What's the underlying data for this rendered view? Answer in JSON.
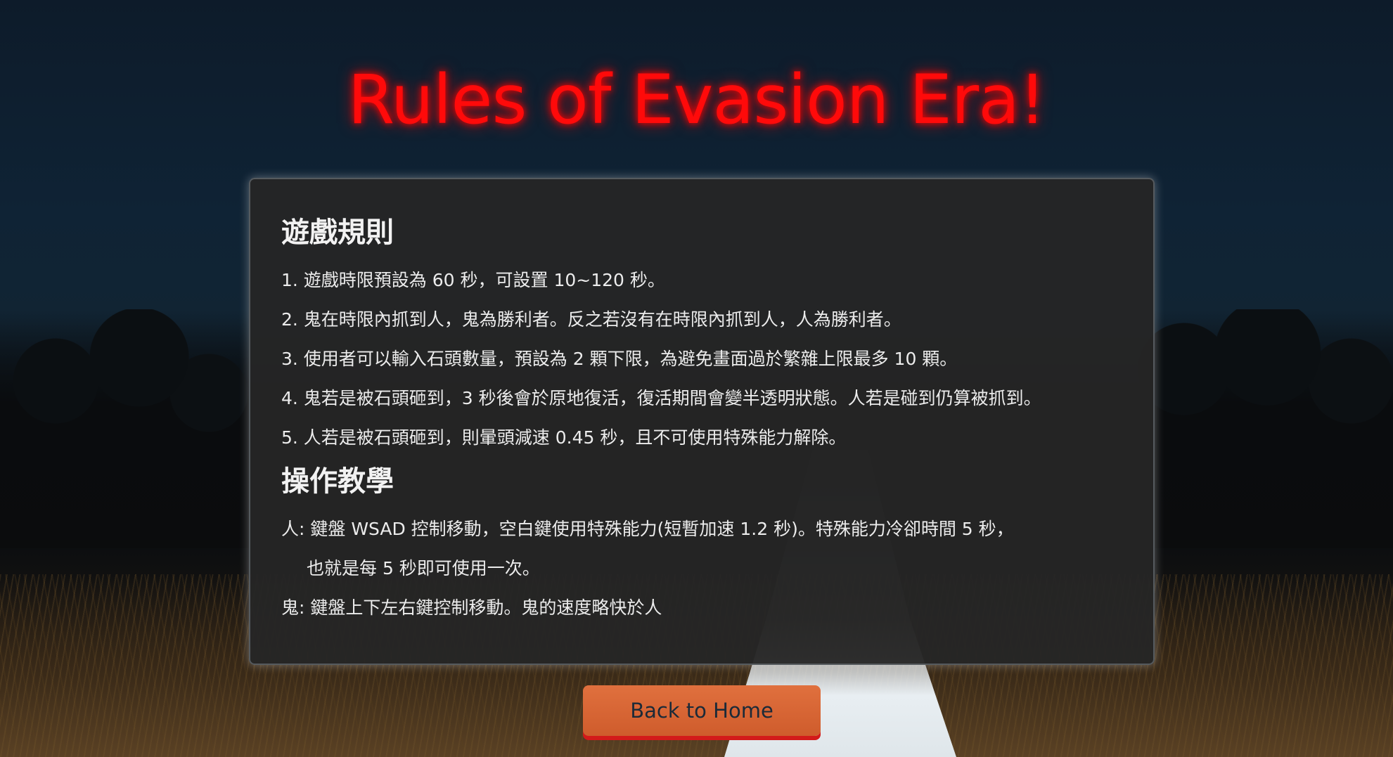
{
  "page": {
    "title": "Rules of Evasion Era!"
  },
  "rules": {
    "heading": "遊戲規則",
    "items": [
      "1. 遊戲時限預設為 60 秒，可設置 10~120 秒。",
      "2. 鬼在時限內抓到人，鬼為勝利者。反之若沒有在時限內抓到人，人為勝利者。",
      "3. 使用者可以輸入石頭數量，預設為 2 顆下限，為避免畫面過於繁雜上限最多 10 顆。",
      "4. 鬼若是被石頭砸到，3 秒後會於原地復活，復活期間會變半透明狀態。人若是碰到仍算被抓到。",
      "5. 人若是被石頭砸到，則暈頭減速 0.45 秒，且不可使用特殊能力解除。"
    ]
  },
  "controls": {
    "heading": "操作教學",
    "human_line1": "人: 鍵盤 WSAD 控制移動，空白鍵使用特殊能力(短暫加速 1.2 秒)。特殊能力冷卻時間 5 秒，",
    "human_line2": "也就是每 5 秒即可使用一次。",
    "ghost_line": "鬼: 鍵盤上下左右鍵控制移動。鬼的速度略快於人"
  },
  "actions": {
    "back_label": "Back to Home"
  },
  "colors": {
    "title": "#ff0a0a",
    "panel_bg": "#262626",
    "button_bg": "#d9663a",
    "button_shadow": "#d31a1a"
  }
}
